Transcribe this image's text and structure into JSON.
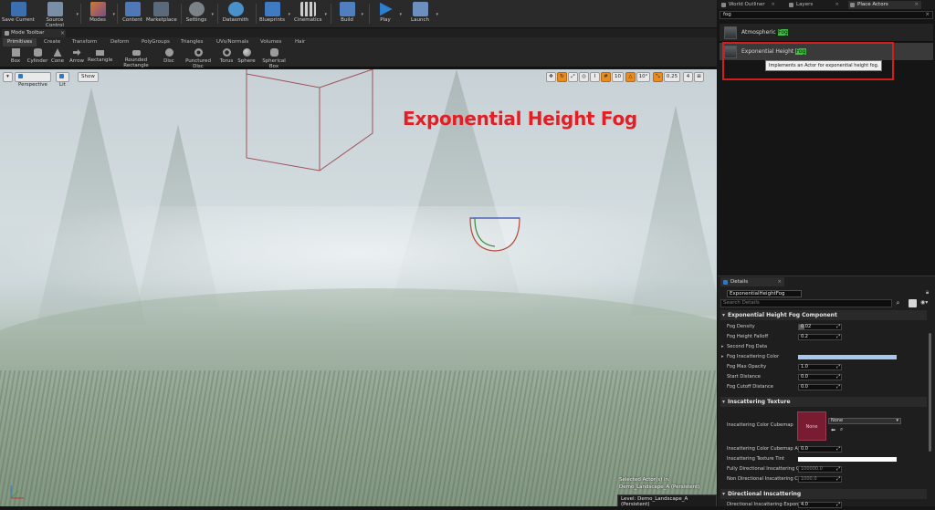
{
  "toolbar": {
    "buttons": [
      {
        "label": "Save Current",
        "icon": "floppy-icon"
      },
      {
        "label": "Source Control",
        "icon": "source-control-icon"
      },
      {
        "label": "Modes",
        "icon": "modes-icon"
      },
      {
        "label": "Content",
        "icon": "content-icon"
      },
      {
        "label": "Marketplace",
        "icon": "marketplace-icon"
      },
      {
        "label": "Settings",
        "icon": "settings-icon"
      },
      {
        "label": "Datasmith",
        "icon": "datasmith-icon"
      },
      {
        "label": "Blueprints",
        "icon": "blueprints-icon"
      },
      {
        "label": "Cinematics",
        "icon": "cinematics-icon"
      },
      {
        "label": "Build",
        "icon": "build-icon"
      },
      {
        "label": "Play",
        "icon": "play-icon"
      },
      {
        "label": "Launch",
        "icon": "launch-icon"
      }
    ]
  },
  "mode_toolbar": {
    "tab_label": "Mode Toolbar",
    "categories": [
      "Primitives",
      "Create",
      "Transform",
      "Deform",
      "PolyGroups",
      "Triangles",
      "UVs/Normals",
      "Volumes",
      "Hair"
    ],
    "shapes": [
      "Box",
      "Cylinder",
      "Cone",
      "Arrow",
      "Rectangle",
      "Rounded Rectangle",
      "Disc",
      "Punctured Disc",
      "Torus",
      "Sphere",
      "Spherical Box"
    ]
  },
  "viewport": {
    "perspective_label": "Perspective",
    "lit_label": "Lit",
    "show_label": "Show",
    "grid_snap": "10",
    "rotation_snap": "10°",
    "scale_snap": "0.25",
    "camera_speed": "4",
    "annotation": "Exponential Height Fog",
    "selected_info_line1": "Selected Actor(s) in:",
    "selected_info_line2": "Demo_Landscape_A (Persistent)",
    "level_label": "Level:  Demo_Landscape_A (Persistent)"
  },
  "right_panel": {
    "tabs": [
      "World Outliner",
      "Layers",
      "Place Actors"
    ],
    "search_value": "fog",
    "results": [
      {
        "prefix": "Atmospheric ",
        "match": "Fog"
      },
      {
        "prefix": "Exponential Height ",
        "match": "Fog"
      }
    ],
    "tooltip": "Implements an Actor for exponential height fog."
  },
  "details": {
    "tab_label": "Details",
    "actor_name": "ExponentialHeightFog",
    "search_placeholder": "Search Details",
    "sections": {
      "component": "Exponential Height Fog Component",
      "inscattering_texture": "Inscattering Texture",
      "directional_inscattering": "Directional Inscattering"
    },
    "props": {
      "fog_density": {
        "label": "Fog Density",
        "value": "0.02"
      },
      "fog_height_falloff": {
        "label": "Fog Height Falloff",
        "value": "0.2"
      },
      "second_fog_data": {
        "label": "Second Fog Data"
      },
      "fog_inscattering_color": {
        "label": "Fog Inscattering Color",
        "color": "#a7c8ee"
      },
      "fog_max_opacity": {
        "label": "Fog Max Opacity",
        "value": "1.0"
      },
      "start_distance": {
        "label": "Start Distance",
        "value": "0.0"
      },
      "fog_cutoff_distance": {
        "label": "Fog Cutoff Distance",
        "value": "0.0"
      },
      "inscattering_cubemap": {
        "label": "Inscattering Color Cubemap",
        "value": "None",
        "thumb_label": "None"
      },
      "inscattering_cubemap_angle": {
        "label": "Inscattering Color Cubemap Angle",
        "value": "0.0"
      },
      "inscattering_texture_tint": {
        "label": "Inscattering Texture Tint",
        "color": "#ffffff"
      },
      "fully_directional": {
        "label": "Fully Directional Inscattering Colo",
        "value": "100000.0"
      },
      "non_directional": {
        "label": "Non Directional Inscattering Color",
        "value": "1000.0"
      },
      "directional_exponent": {
        "label": "Directional Inscattering Exponent",
        "value": "4.0"
      }
    }
  }
}
